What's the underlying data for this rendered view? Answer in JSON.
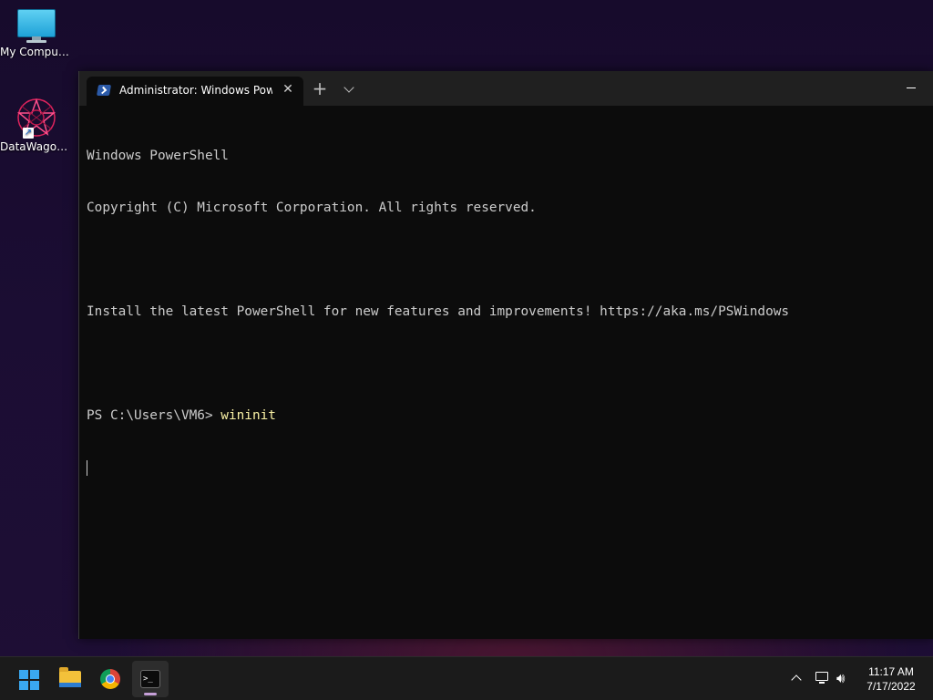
{
  "desktop": {
    "icons": [
      {
        "label": "My Computer",
        "icon": "monitor-icon"
      },
      {
        "label": "DataWagon...",
        "icon": "datawagon-app-icon"
      }
    ]
  },
  "terminal": {
    "tab_title": "Administrator: Windows PowerShell",
    "tab_icon": "powershell-icon",
    "new_tab_glyph": "+",
    "close_glyph": "✕",
    "lines": {
      "l1": "Windows PowerShell",
      "l2": "Copyright (C) Microsoft Corporation. All rights reserved.",
      "l3": "",
      "l4": "Install the latest PowerShell for new features and improvements! https://aka.ms/PSWindows",
      "l5": ""
    },
    "prompt": "PS C:\\Users\\VM6> ",
    "command": "wininit"
  },
  "taskbar": {
    "apps": [
      "start-icon",
      "file-explorer-icon",
      "chrome-icon",
      "terminal-icon"
    ],
    "tray": {
      "time": "11:17 AM",
      "date": "7/17/2022"
    }
  },
  "colors": {
    "console_bg": "#0c0c0c",
    "console_text": "#cccccc",
    "command_text": "#f9f1a5",
    "titlebar_bg": "#202020",
    "taskbar_bg": "#1b1b1b"
  }
}
